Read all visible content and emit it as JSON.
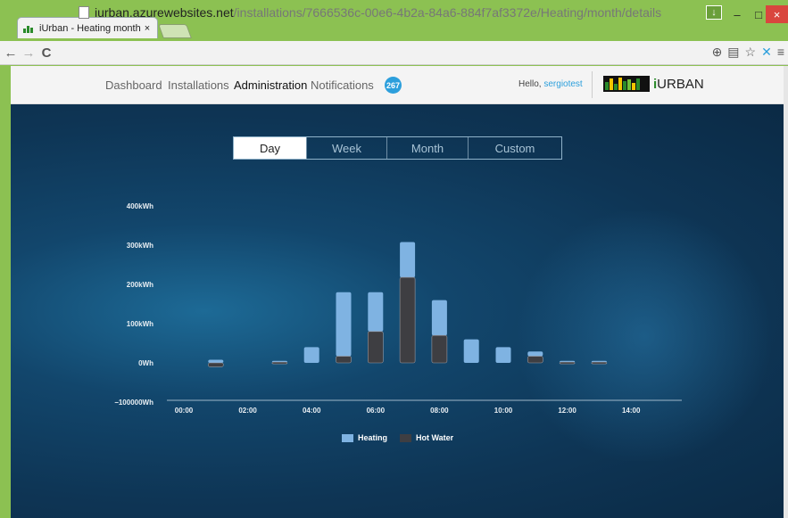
{
  "browser": {
    "tab_title": "iUrban - Heating month D",
    "tab_close": "×",
    "url_host": "iurban.azurewebsites.net",
    "url_path": "/installations/7666536c-00e6-4b2a-84a6-884f7af3372e/Heating/month/details",
    "back_icon": "←",
    "forward_icon": "→",
    "reload_icon": "C"
  },
  "nav": {
    "items": [
      "Dashboard",
      "Installations",
      "Administration",
      "Notifications"
    ],
    "active": "Administration",
    "notification_count": "267",
    "hello": "Hello, ",
    "username": "sergiotest",
    "logo_text": "URBAN",
    "logo_prefix": "i"
  },
  "period_tabs": [
    "Day",
    "Week",
    "Month",
    "Custom"
  ],
  "period_selected": "Day",
  "colors": {
    "heating": "#7fb3e2",
    "hot_water": "#3e3e42",
    "axis": "#9fb7c9"
  },
  "chart_data": {
    "type": "bar",
    "stacked": true,
    "y_tick_labels": [
      "400kWh",
      "300kWh",
      "200kWh",
      "100kWh",
      "0Wh",
      "−100000Wh"
    ],
    "y_ticks": [
      400,
      300,
      200,
      100,
      0,
      -100
    ],
    "x_tick_labels": [
      "00:00",
      "02:00",
      "04:00",
      "06:00",
      "08:00",
      "10:00",
      "12:00",
      "14:00"
    ],
    "x_ticks": [
      0,
      2,
      4,
      6,
      8,
      10,
      12,
      14
    ],
    "ylim": [
      -100,
      400
    ],
    "hours": [
      1,
      3,
      4,
      5,
      6,
      7,
      8,
      9,
      10,
      11,
      12,
      13
    ],
    "series": [
      {
        "name": "Heating",
        "values": [
          8,
          3,
          40,
          163,
          100,
          90,
          90,
          60,
          40,
          12,
          3,
          3
        ]
      },
      {
        "name": "Hot Water",
        "values": [
          -10,
          2,
          0,
          17,
          80,
          218,
          70,
          0,
          0,
          17,
          2,
          2
        ]
      }
    ]
  }
}
